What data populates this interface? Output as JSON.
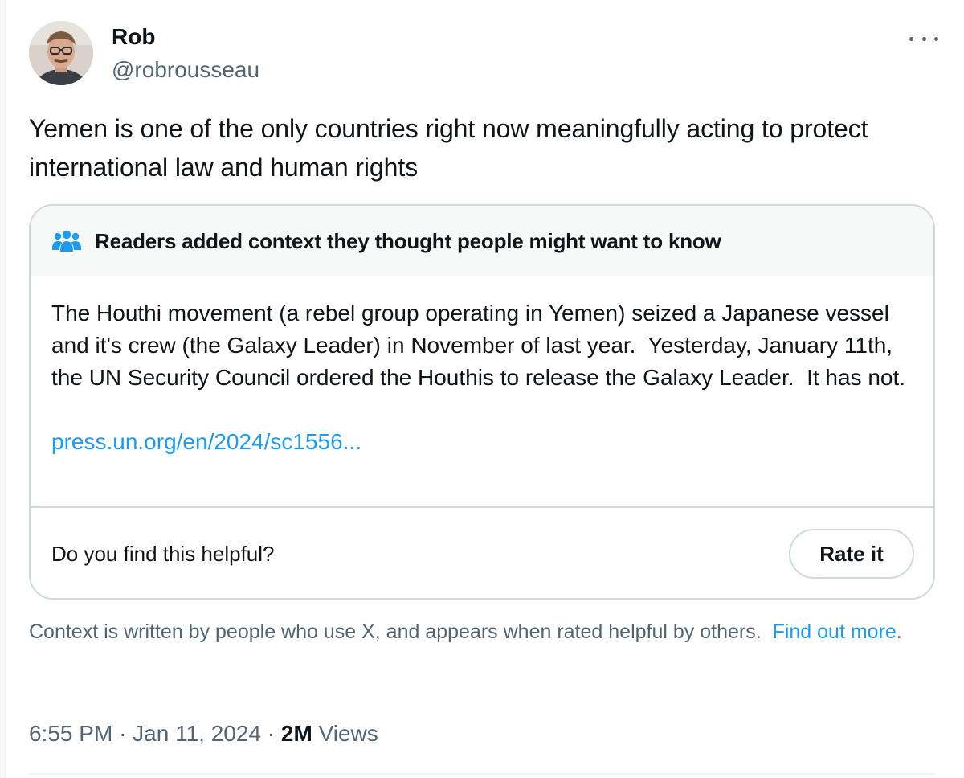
{
  "author": {
    "name": "Rob",
    "handle": "@robrousseau"
  },
  "tweet": {
    "text": "Yemen is one of the only countries right now meaningfully acting to protect international law and human rights"
  },
  "note": {
    "header": "Readers added context they thought people might want to know",
    "header_icon": "people-icon",
    "body": "The Houthi movement (a rebel group operating in Yemen) seized a Japanese vessel and it's crew (the Galaxy Leader) in November of last year.  Yesterday, January 11th, the UN Security Council ordered the Houthis to release the Galaxy Leader.  It has not.",
    "link": "press.un.org/en/2024/sc1556...",
    "helpful_question": "Do you find this helpful?",
    "rate_label": "Rate it"
  },
  "disclaimer": {
    "text": "Context is written by people who use X, and appears when rated helpful by others.",
    "link_label": "Find out more",
    "suffix": "."
  },
  "meta": {
    "time": "6:55 PM",
    "separator": " · ",
    "date": "Jan 11, 2024",
    "views_count": "2M",
    "views_label": "Views"
  },
  "colors": {
    "accent": "#1d9bf0",
    "text_primary": "#0f1419",
    "text_secondary": "#536471",
    "border": "#cfd9de"
  }
}
